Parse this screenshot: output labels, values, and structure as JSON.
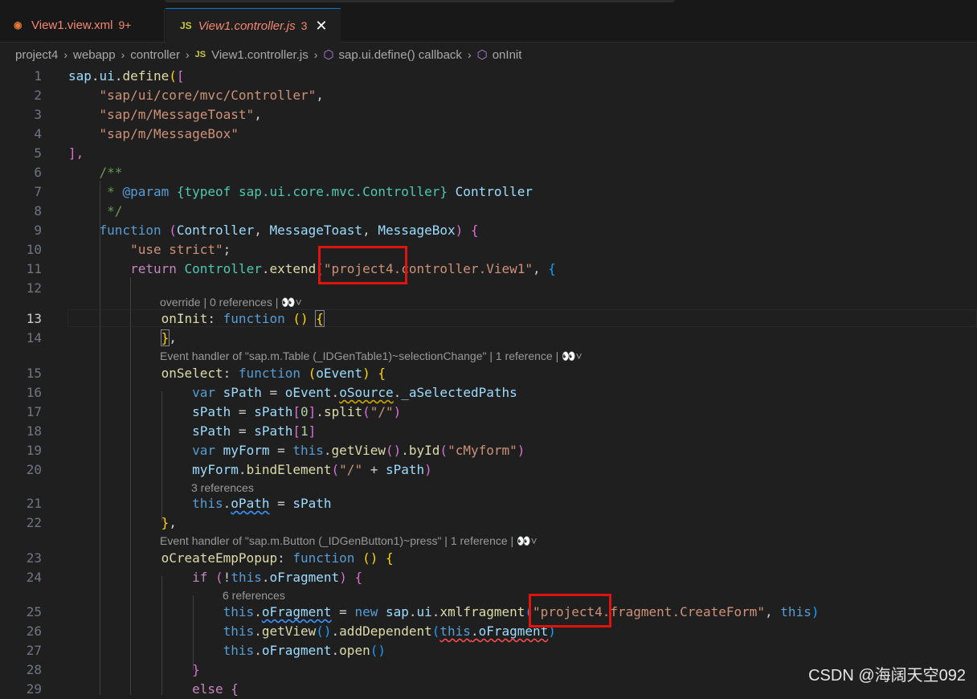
{
  "tabs": [
    {
      "label": "View1.view.xml",
      "badge": "9+",
      "icon": "rss-icon"
    },
    {
      "label": "View1.controller.js",
      "badge": "3",
      "icon": "js-icon",
      "close": "✕"
    }
  ],
  "breadcrumb": {
    "items": [
      "project4",
      "webapp",
      "controller",
      "View1.controller.js",
      "sap.ui.define() callback",
      "onInit"
    ],
    "separator": "›",
    "js_badge": "JS"
  },
  "editor": {
    "line_numbers": [
      "1",
      "2",
      "3",
      "4",
      "5",
      "6",
      "7",
      "8",
      "9",
      "10",
      "11",
      "12",
      "13",
      "14",
      "15",
      "16",
      "17",
      "18",
      "19",
      "20",
      "21",
      "22",
      "23",
      "24",
      "25",
      "26",
      "27",
      "28",
      "29"
    ],
    "active_line": "13",
    "codelens": [
      "override | 0 references | 👀˅",
      "Event handler of \"sap.m.Table (_IDGenTable1)~selectionChange\" | 1 reference | 👀˅",
      "3 references",
      "Event handler of \"sap.m.Button (_IDGenButton1)~press\" | 1 reference | 👀˅",
      "6 references"
    ],
    "code": {
      "l1_a": "sap",
      "l1_b": ".",
      "l1_c": "ui",
      "l1_d": ".",
      "l1_e": "define",
      "l1_f": "(",
      "l1_g": "[",
      "l2": "\"sap/ui/core/mvc/Controller\"",
      "l3": "\"sap/m/MessageToast\"",
      "l4": "\"sap/m/MessageBox\"",
      "l5": "],",
      "l6": "/**",
      "l7_a": " * ",
      "l7_b": "@param",
      "l7_c": "{typeof sap.ui.core.mvc.Controller}",
      "l7_d": "Controller",
      "l8": " */",
      "l9_a": "function",
      "l9_b": "Controller",
      "l9_c": "MessageToast",
      "l9_d": "MessageBox",
      "l10": "\"use strict\"",
      "l11_a": "return",
      "l11_b": "Controller",
      "l11_c": "extend",
      "l11_d": "\"project4.controller.View1\"",
      "l13_a": "onInit",
      "l13_b": "function",
      "l15_a": "onSelect",
      "l15_b": "function",
      "l15_c": "oEvent",
      "l16_a": "var",
      "l16_b": "sPath",
      "l16_c": "oEvent",
      "l16_d": "oSource",
      "l16_e": "_aSelectedPaths",
      "l17_a": "sPath",
      "l17_b": "sPath",
      "l17_c": "0",
      "l17_d": "split",
      "l17_e": "\"/\"",
      "l18_a": "sPath",
      "l18_b": "sPath",
      "l18_c": "1",
      "l19_a": "var",
      "l19_b": "myForm",
      "l19_c": "this",
      "l19_d": "getView",
      "l19_e": "byId",
      "l19_f": "\"cMyform\"",
      "l20_a": "myForm",
      "l20_b": "bindElement",
      "l20_c": "\"/\"",
      "l20_d": "sPath",
      "l21_a": "this",
      "l21_b": "oPath",
      "l21_c": "sPath",
      "l23_a": "oCreateEmpPopup",
      "l23_b": "function",
      "l24_a": "if",
      "l24_b": "this",
      "l24_c": "oFragment",
      "l25_a": "this",
      "l25_b": "oFragment",
      "l25_c": "new",
      "l25_d": "sap",
      "l25_e": "ui",
      "l25_f": "xmlfragment",
      "l25_g": "\"project4.fragment.CreateForm\"",
      "l25_h": "this",
      "l26_a": "this",
      "l26_b": "getView",
      "l26_c": "addDependent",
      "l26_d": "this",
      "l26_e": "oFragment",
      "l27_a": "this",
      "l27_b": "oFragment",
      "l27_c": "open",
      "l29": "else {"
    }
  },
  "watermark": "CSDN @海阔天空092",
  "colors": {
    "keyword": "#569cd6",
    "control": "#c586c0",
    "string": "#ce9178",
    "function": "#dcdcaa",
    "variable": "#9cdcfe",
    "class": "#4ec9b0",
    "comment": "#6a9955",
    "highlight": "#e0140f"
  }
}
